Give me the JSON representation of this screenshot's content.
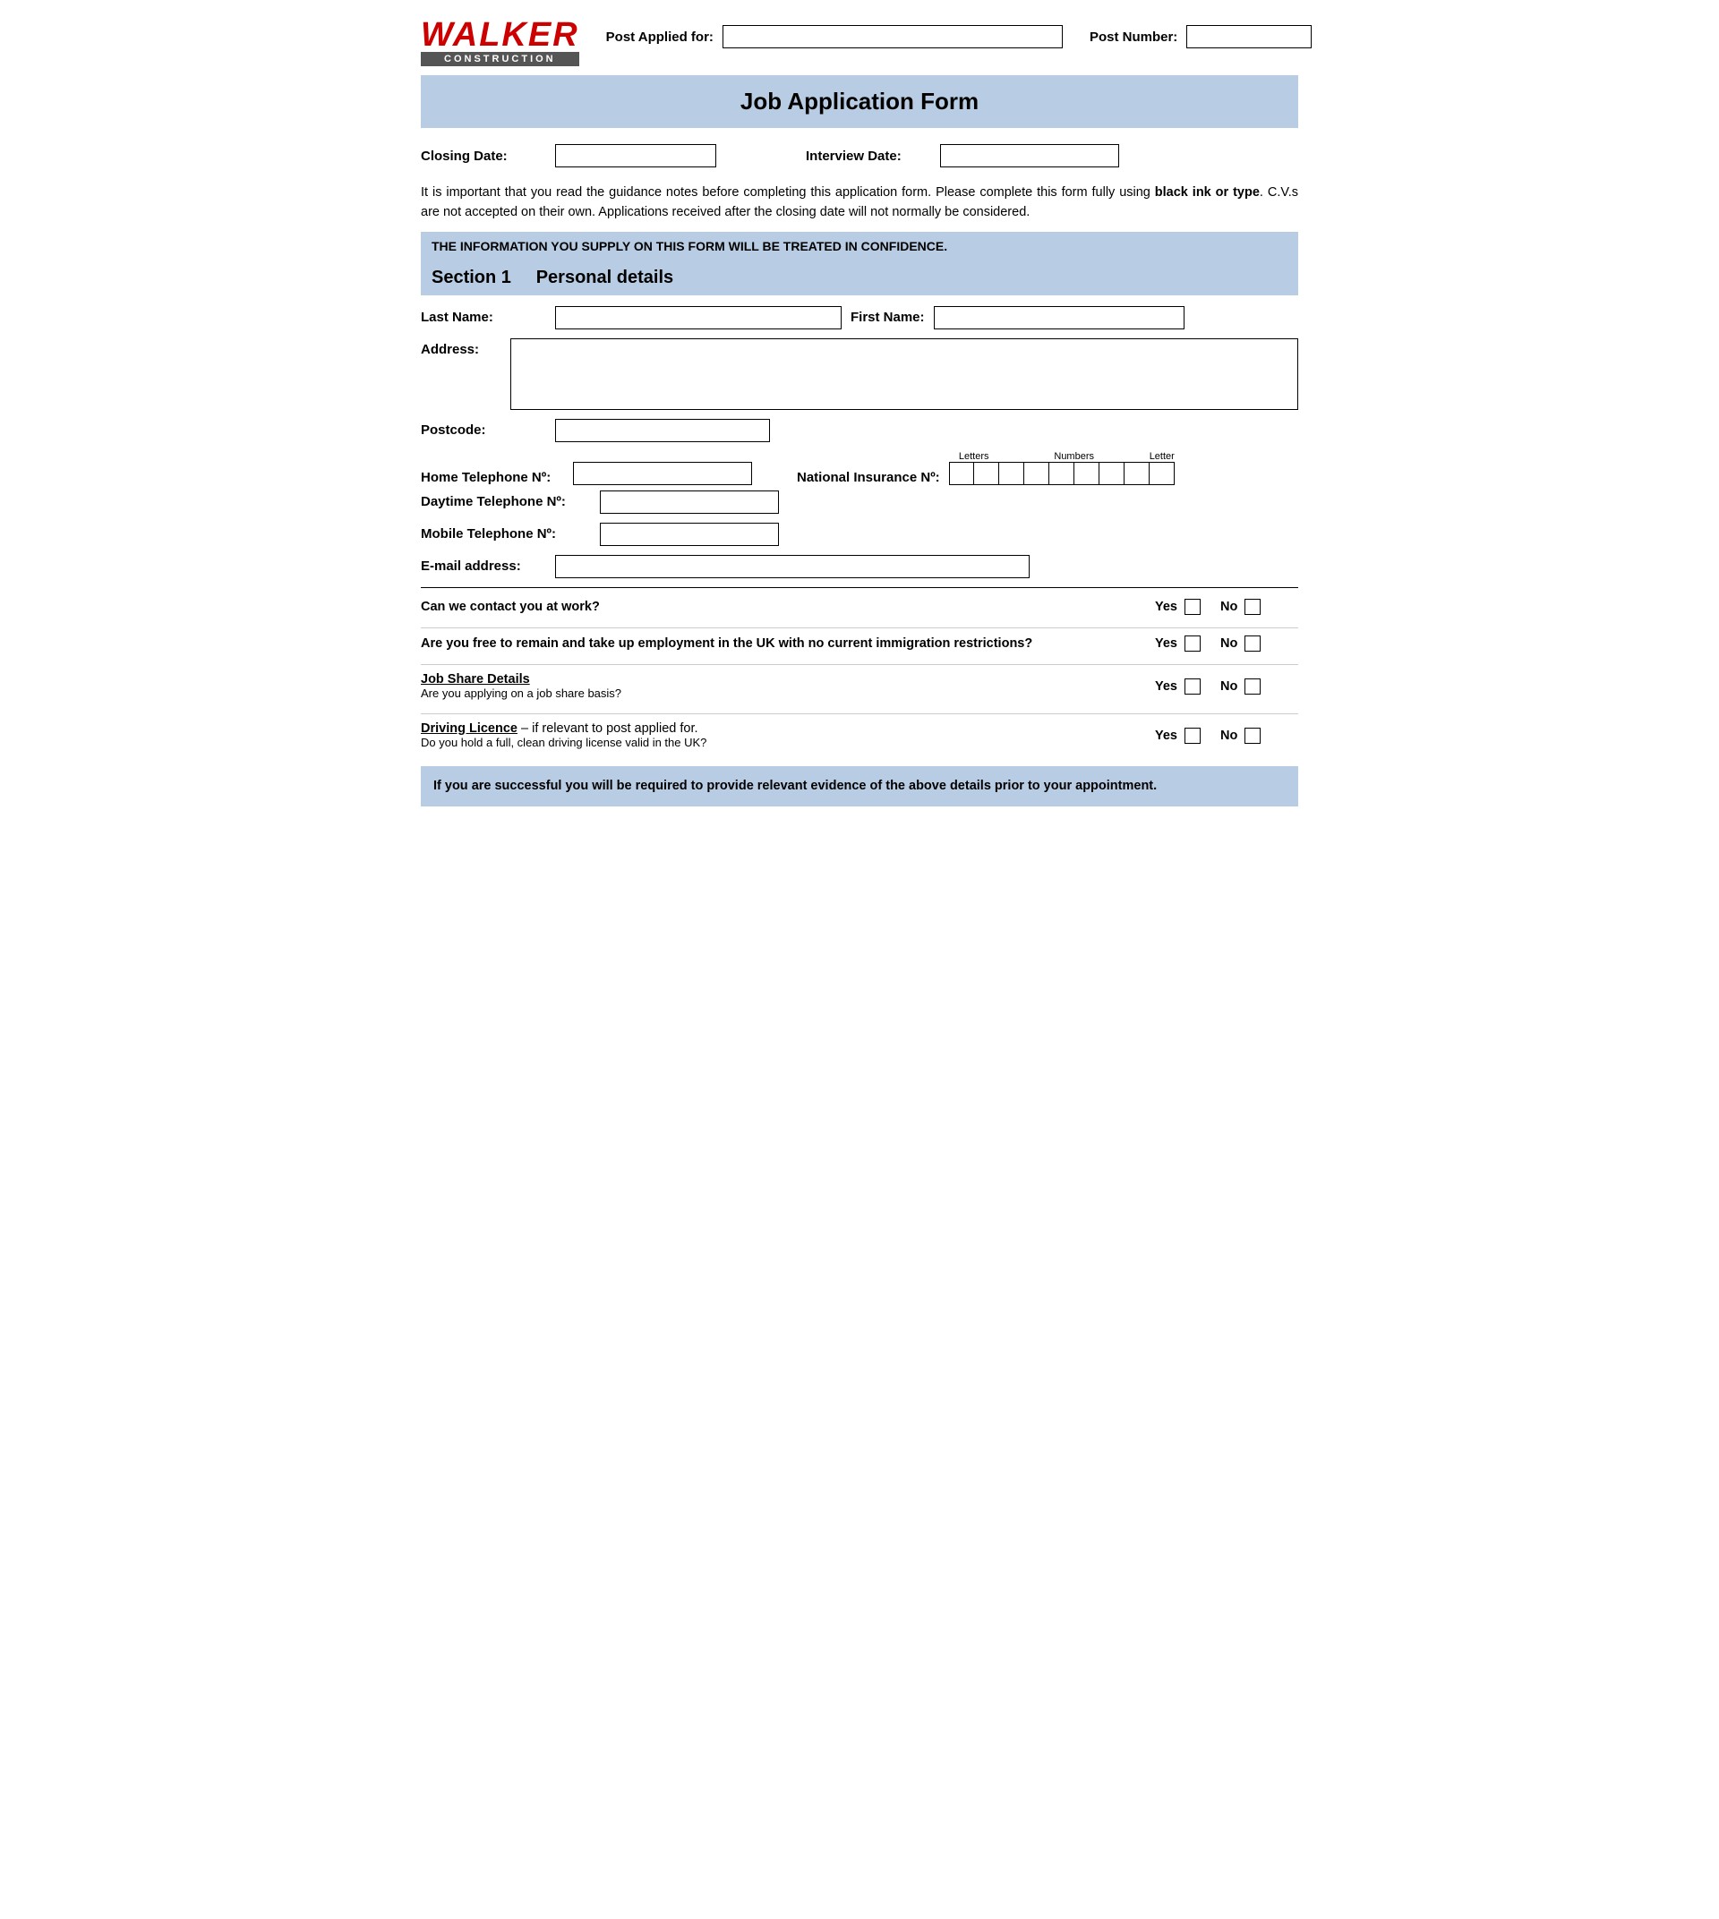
{
  "logo": {
    "name": "WALKER",
    "subtitle": "CONSTRUCTION"
  },
  "header": {
    "post_applied_label": "Post Applied for:",
    "post_number_label": "Post Number:"
  },
  "title_banner": {
    "text": "Job Application Form"
  },
  "dates": {
    "closing_label": "Closing Date:",
    "interview_label": "Interview Date:"
  },
  "intro": {
    "text": "It is important that you read the guidance notes before completing this application form. Please complete this form fully using black ink or type. C.V.s are not accepted on their own. Applications received after the closing date will not normally be considered."
  },
  "confidence_notice": "THE INFORMATION YOU SUPPLY ON THIS FORM WILL BE TREATED IN CONFIDENCE.",
  "section1": {
    "heading": "Section 1",
    "title": "Personal details"
  },
  "fields": {
    "last_name_label": "Last Name:",
    "first_name_label": "First Name:",
    "address_label": "Address:",
    "postcode_label": "Postcode:",
    "home_tel_label": "Home Telephone Nº:",
    "national_insurance_label": "National Insurance Nº:",
    "ni_letters_label": "Letters",
    "ni_numbers_label": "Numbers",
    "ni_letter_label": "Letter",
    "daytime_tel_label": "Daytime Telephone Nº:",
    "mobile_tel_label": "Mobile Telephone Nº:",
    "email_label": "E-mail address:"
  },
  "questions": {
    "contact_work": {
      "text": "Can we contact you at work?",
      "yes": "Yes",
      "no": "No"
    },
    "free_to_work": {
      "text": "Are you free to remain and take up employment in the UK with no current immigration restrictions?",
      "yes": "Yes",
      "no": "No"
    },
    "job_share": {
      "heading": "Job Share Details",
      "sub": "Are you applying on a job share basis?",
      "yes": "Yes",
      "no": "No"
    },
    "driving_licence": {
      "heading": "Driving Licence",
      "sub_prefix": " – if relevant to post applied for.",
      "sub2": "Do you hold a full, clean driving license valid in the UK?",
      "yes": "Yes",
      "no": "No"
    }
  },
  "footer": {
    "text": "If you are successful you will be required to provide relevant evidence of the above details prior to your appointment."
  }
}
